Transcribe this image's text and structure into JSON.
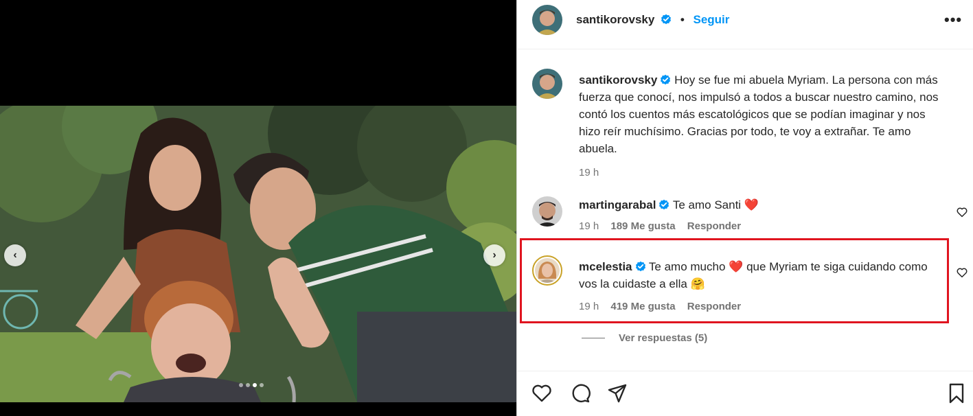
{
  "post": {
    "username": "santikorovsky",
    "follow_label": "Seguir",
    "separator": "•",
    "more_label": "•••",
    "caption": {
      "username": "santikorovsky",
      "text": "Hoy se fue mi abuela Myriam. La persona con más fuerza que conocí, nos impulsó a todos a buscar nuestro camino, nos contó los cuentos más escatológicos que se podían imaginar y nos hizo reír muchísimo. Gracias por todo, te voy a extrañar. Te amo abuela.",
      "time": "19 h"
    }
  },
  "carousel": {
    "prev_label": "‹",
    "next_label": "›",
    "total_slides": 4,
    "active_slide": 3
  },
  "comments": [
    {
      "username": "martingarabal",
      "text": "Te amo Santi",
      "emoji": "❤️",
      "time": "19 h",
      "likes": "189 Me gusta",
      "reply": "Responder"
    },
    {
      "username": "mcelestia",
      "text_a": "Te amo mucho",
      "emoji_a": "❤️",
      "text_b": "que Myriam te siga cuidando como vos la cuidaste a ella",
      "emoji_b": "🤗",
      "time": "19 h",
      "likes": "419 Me gusta",
      "reply": "Responder"
    }
  ],
  "view_replies": "Ver respuestas (5)",
  "colors": {
    "accent": "#0095f6",
    "verified": "#0095f6",
    "highlight": "#e0141f",
    "heart": "#e8162b"
  },
  "icons": [
    "heart-icon",
    "comment-icon",
    "share-icon",
    "bookmark-icon",
    "verified-badge-icon",
    "more-options-icon"
  ]
}
